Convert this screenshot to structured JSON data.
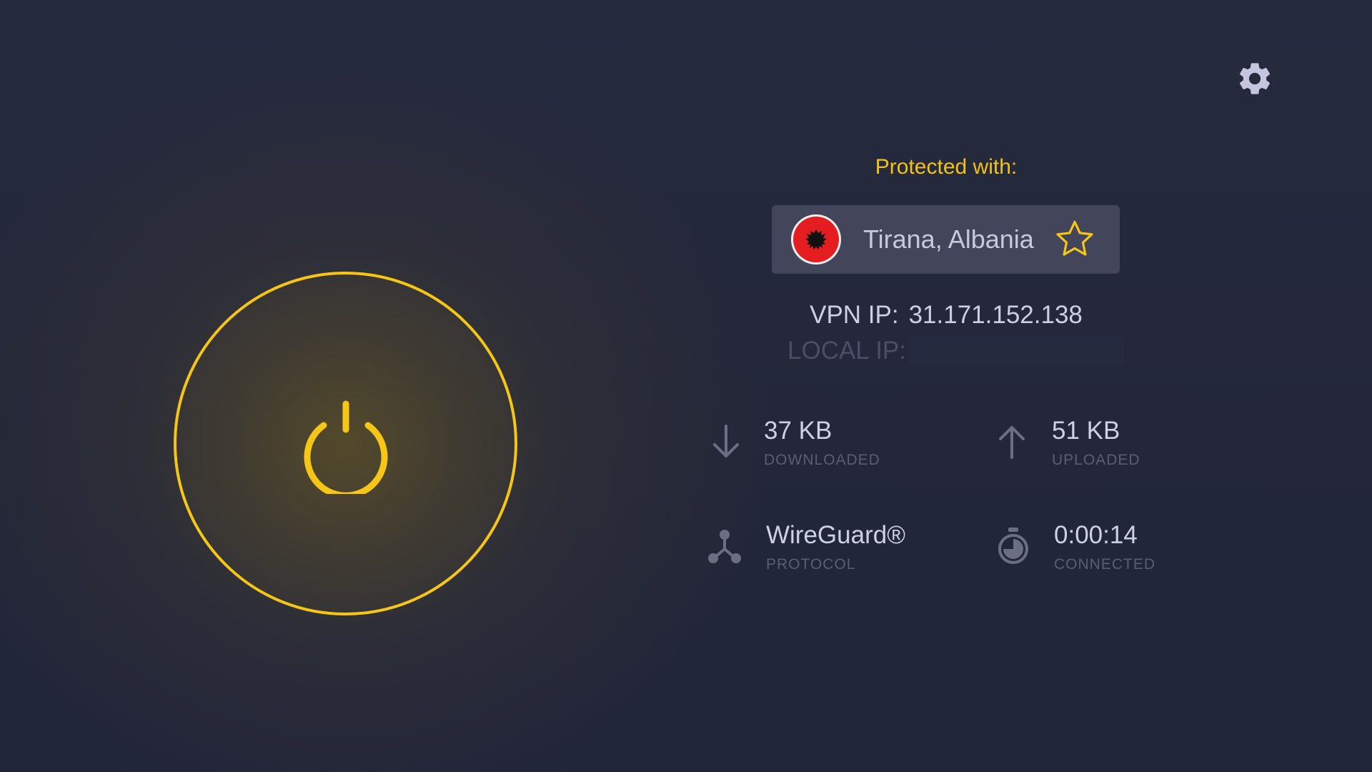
{
  "header": {
    "settings_icon": "gear-icon"
  },
  "power": {
    "icon": "power-icon",
    "state_color": "#f5c518"
  },
  "connection": {
    "protected_label": "Protected with:",
    "location": "Tirana, Albania",
    "flag_icon": "albania-flag-icon",
    "favorite_icon": "star-outline-icon",
    "vpn_ip_label": "VPN IP:",
    "vpn_ip_value": "31.171.152.138",
    "local_ip_label": "LOCAL IP:"
  },
  "stats": {
    "downloaded": {
      "value": "37 KB",
      "label": "DOWNLOADED",
      "icon": "arrow-down-icon"
    },
    "uploaded": {
      "value": "51 KB",
      "label": "UPLOADED",
      "icon": "arrow-up-icon"
    },
    "protocol": {
      "value": "WireGuard®",
      "label": "PROTOCOL",
      "icon": "protocol-nodes-icon"
    },
    "connected": {
      "value": "0:00:14",
      "label": "CONNECTED",
      "icon": "stopwatch-icon"
    }
  },
  "colors": {
    "accent": "#f5c518",
    "background": "#24283b",
    "card": "#43465a",
    "muted": "#5a5d73"
  }
}
